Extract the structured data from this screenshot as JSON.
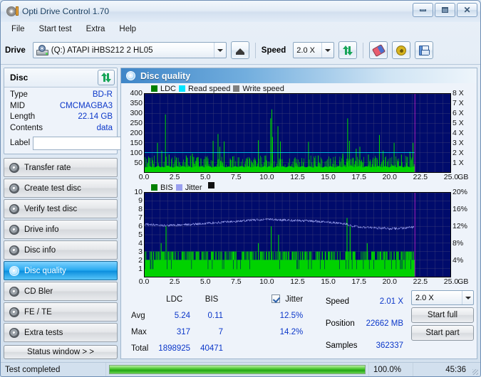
{
  "window": {
    "title": "Opti Drive Control 1.70",
    "icon": "disc-icon",
    "controls": {
      "minimize": "minimize",
      "maximize": "maximize",
      "close": "close"
    }
  },
  "menu": {
    "items": [
      "File",
      "Start test",
      "Extra",
      "Help"
    ]
  },
  "toolbar": {
    "drive_label": "Drive",
    "drive_value": "(Q:)  ATAPI iHBS212  2 HL05",
    "eject_title": "eject",
    "speed_label": "Speed",
    "speed_value": "2.0 X",
    "refresh_title": "refresh",
    "erase_title": "erase",
    "settings_title": "settings",
    "save_title": "save"
  },
  "disc": {
    "title": "Disc",
    "refresh_title": "refresh-disc",
    "rows": [
      {
        "key": "Type",
        "value": "BD-R"
      },
      {
        "key": "MID",
        "value": "CMCMAGBA3"
      },
      {
        "key": "Length",
        "value": "22.14 GB"
      },
      {
        "key": "Contents",
        "value": "data"
      }
    ],
    "label_key": "Label",
    "label_value": "",
    "label_placeholder": ""
  },
  "nav": {
    "items": [
      {
        "label": "Transfer rate",
        "selected": false
      },
      {
        "label": "Create test disc",
        "selected": false
      },
      {
        "label": "Verify test disc",
        "selected": false
      },
      {
        "label": "Drive info",
        "selected": false
      },
      {
        "label": "Disc info",
        "selected": false
      },
      {
        "label": "Disc quality",
        "selected": true
      },
      {
        "label": "CD Bler",
        "selected": false
      },
      {
        "label": "FE / TE",
        "selected": false
      },
      {
        "label": "Extra tests",
        "selected": false
      }
    ],
    "status_window": "Status window > >"
  },
  "panel": {
    "title": "Disc quality",
    "icon": "disc-quality-icon"
  },
  "chart_data": [
    {
      "type": "line",
      "name": "ldc-chart",
      "title": "",
      "xlabel": "GB",
      "ylabel": "",
      "xlim": [
        0,
        25
      ],
      "ylim": [
        0,
        400
      ],
      "xticks": [
        "0.0",
        "2.5",
        "5.0",
        "7.5",
        "10.0",
        "12.5",
        "15.0",
        "17.5",
        "20.0",
        "22.5",
        "25.0"
      ],
      "xtick_values": [
        0,
        2.5,
        5,
        7.5,
        10,
        12.5,
        15,
        17.5,
        20,
        22.5,
        25
      ],
      "yticks": [
        "50",
        "100",
        "150",
        "200",
        "250",
        "300",
        "350",
        "400"
      ],
      "ytick_values": [
        50,
        100,
        150,
        200,
        250,
        300,
        350,
        400
      ],
      "y2label": "",
      "y2lim": [
        0,
        8
      ],
      "y2ticks": [
        "1 X",
        "2 X",
        "3 X",
        "4 X",
        "5 X",
        "6 X",
        "7 X",
        "8 X"
      ],
      "y2tick_values": [
        1,
        2,
        3,
        4,
        5,
        6,
        7,
        8
      ],
      "grid": true,
      "bg": "#000b6b",
      "legend": [
        {
          "label": "LDC",
          "color": "#008000"
        },
        {
          "label": "Read speed",
          "color": "#00e5ff"
        },
        {
          "label": "Write speed",
          "color": "#808080"
        }
      ],
      "data_end_marker_x": 22.1,
      "marker_color": "#c71fc7",
      "series": [
        {
          "name": "LDC",
          "color": "#00d200",
          "type": "spike-area",
          "baseline": [
            22,
            26,
            24,
            28,
            30,
            25,
            27,
            23,
            26,
            29,
            31,
            27,
            25,
            28,
            24,
            26,
            30,
            33,
            29,
            27,
            25,
            23,
            26,
            28,
            30,
            27,
            25,
            29,
            31,
            28,
            26,
            24,
            27,
            30,
            25,
            23,
            26,
            28,
            31,
            27,
            25,
            28,
            30,
            26,
            24,
            27,
            29,
            31,
            28,
            25,
            23,
            26,
            29,
            27,
            25,
            28,
            30,
            32,
            28,
            26,
            24,
            27,
            29,
            25,
            23,
            26,
            28,
            30,
            27,
            25,
            28,
            31,
            29,
            26,
            24,
            27,
            30,
            28,
            25,
            23,
            26,
            29,
            27,
            31,
            28,
            25,
            23,
            27,
            29,
            26,
            24,
            28,
            30,
            27,
            25,
            23,
            26,
            29,
            31,
            27,
            25,
            28,
            30,
            26,
            24,
            27,
            29,
            31,
            28,
            25,
            23,
            26,
            29,
            27,
            25,
            28,
            30,
            28,
            26,
            24,
            27,
            30,
            28,
            25,
            23,
            26,
            29,
            27,
            31,
            28,
            25,
            23,
            26,
            29,
            27,
            24,
            28,
            30,
            27,
            25,
            23,
            26,
            29,
            31,
            28,
            25,
            27,
            30,
            26,
            24,
            28,
            30,
            32,
            29,
            26,
            24,
            27,
            29,
            31,
            28,
            25,
            23,
            27,
            30,
            28,
            25,
            23,
            26,
            29,
            27,
            25,
            28,
            31,
            29,
            26,
            24,
            27,
            30,
            28,
            26,
            24,
            27,
            30,
            32,
            29,
            26,
            24,
            28,
            31,
            29,
            26,
            24,
            27,
            30,
            28,
            25,
            23,
            26,
            29,
            27
          ],
          "spikes": [
            {
              "x": 1.05,
              "y": 150
            },
            {
              "x": 1.4,
              "y": 110
            },
            {
              "x": 1.7,
              "y": 295
            },
            {
              "x": 2.0,
              "y": 90
            },
            {
              "x": 2.6,
              "y": 75
            },
            {
              "x": 3.4,
              "y": 85
            },
            {
              "x": 3.9,
              "y": 95
            },
            {
              "x": 4.6,
              "y": 70
            },
            {
              "x": 5.6,
              "y": 160
            },
            {
              "x": 6.0,
              "y": 195
            },
            {
              "x": 6.15,
              "y": 130
            },
            {
              "x": 6.5,
              "y": 157
            },
            {
              "x": 7.2,
              "y": 80
            },
            {
              "x": 8.6,
              "y": 70
            },
            {
              "x": 9.3,
              "y": 163
            },
            {
              "x": 9.9,
              "y": 85
            },
            {
              "x": 10.3,
              "y": 275
            },
            {
              "x": 10.4,
              "y": 321
            },
            {
              "x": 10.45,
              "y": 180
            },
            {
              "x": 10.9,
              "y": 235
            },
            {
              "x": 11.1,
              "y": 157
            },
            {
              "x": 12.3,
              "y": 75
            },
            {
              "x": 13.4,
              "y": 155
            },
            {
              "x": 14.2,
              "y": 85
            },
            {
              "x": 15.2,
              "y": 70
            },
            {
              "x": 16.2,
              "y": 95
            },
            {
              "x": 16.6,
              "y": 275
            },
            {
              "x": 16.75,
              "y": 160
            },
            {
              "x": 17.3,
              "y": 120
            },
            {
              "x": 17.6,
              "y": 130
            },
            {
              "x": 18.3,
              "y": 90
            },
            {
              "x": 19.2,
              "y": 190
            },
            {
              "x": 19.5,
              "y": 110
            },
            {
              "x": 20.4,
              "y": 150
            },
            {
              "x": 21.0,
              "y": 90
            },
            {
              "x": 21.7,
              "y": 105
            },
            {
              "x": 21.95,
              "y": 150
            }
          ]
        },
        {
          "name": "Read speed",
          "color": "#00e5ff",
          "type": "line",
          "axis": "right",
          "value": 2.01,
          "x_start": 0,
          "x_end": 22.1
        }
      ]
    },
    {
      "type": "line",
      "name": "bis-jitter-chart",
      "title": "",
      "xlabel": "GB",
      "ylabel": "",
      "xlim": [
        0,
        25
      ],
      "ylim": [
        0,
        10
      ],
      "xticks": [
        "0.0",
        "2.5",
        "5.0",
        "7.5",
        "10.0",
        "12.5",
        "15.0",
        "17.5",
        "20.0",
        "22.5",
        "25.0"
      ],
      "xtick_values": [
        0,
        2.5,
        5,
        7.5,
        10,
        12.5,
        15,
        17.5,
        20,
        22.5,
        25
      ],
      "yticks": [
        "1",
        "2",
        "3",
        "4",
        "5",
        "6",
        "7",
        "8",
        "9",
        "10"
      ],
      "ytick_values": [
        1,
        2,
        3,
        4,
        5,
        6,
        7,
        8,
        9,
        10
      ],
      "y2lim": [
        0,
        20
      ],
      "y2ticks": [
        "4%",
        "8%",
        "12%",
        "16%",
        "20%"
      ],
      "y2tick_values": [
        4,
        8,
        12,
        16,
        20
      ],
      "grid": true,
      "bg": "#000b6b",
      "legend": [
        {
          "label": "BIS",
          "color": "#008000"
        },
        {
          "label": "Jitter",
          "color": "#9aa0f0"
        }
      ],
      "data_end_marker_x": 22.1,
      "marker_color": "#c71fc7",
      "series": [
        {
          "name": "BIS",
          "color": "#00d200",
          "type": "spike-area",
          "baseline_level": 2,
          "spikes_level3_density": 0.32,
          "spikes": [
            {
              "x": 1.35,
              "y": 4
            },
            {
              "x": 1.75,
              "y": 6
            },
            {
              "x": 2.3,
              "y": 3
            },
            {
              "x": 3.1,
              "y": 3
            },
            {
              "x": 4.2,
              "y": 3
            },
            {
              "x": 5.6,
              "y": 3
            },
            {
              "x": 6.3,
              "y": 3
            },
            {
              "x": 7.1,
              "y": 3
            },
            {
              "x": 9.3,
              "y": 4
            },
            {
              "x": 10.35,
              "y": 6
            },
            {
              "x": 10.95,
              "y": 5
            },
            {
              "x": 12.1,
              "y": 3
            },
            {
              "x": 13.5,
              "y": 3
            },
            {
              "x": 14.8,
              "y": 3
            },
            {
              "x": 16.55,
              "y": 7
            },
            {
              "x": 16.8,
              "y": 6
            },
            {
              "x": 17.2,
              "y": 3
            },
            {
              "x": 18.2,
              "y": 4
            },
            {
              "x": 19.3,
              "y": 3
            },
            {
              "x": 20.4,
              "y": 3
            },
            {
              "x": 21.4,
              "y": 3
            }
          ]
        },
        {
          "name": "Jitter",
          "color": "#9aa0f0",
          "type": "line",
          "axis": "right",
          "points": [
            [
              0.0,
              12.5
            ],
            [
              0.5,
              12.4
            ],
            [
              1.0,
              12.3
            ],
            [
              1.5,
              12.2
            ],
            [
              2.0,
              12.3
            ],
            [
              2.5,
              12.3
            ],
            [
              3.0,
              12.4
            ],
            [
              3.5,
              12.4
            ],
            [
              4.0,
              12.5
            ],
            [
              4.5,
              12.6
            ],
            [
              5.0,
              12.7
            ],
            [
              5.5,
              12.8
            ],
            [
              6.0,
              12.9
            ],
            [
              6.5,
              13.0
            ],
            [
              7.0,
              13.1
            ],
            [
              7.5,
              13.2
            ],
            [
              8.0,
              13.3
            ],
            [
              8.5,
              13.4
            ],
            [
              9.0,
              13.5
            ],
            [
              9.5,
              13.6
            ],
            [
              10.0,
              13.7
            ],
            [
              10.5,
              13.6
            ],
            [
              11.0,
              13.5
            ],
            [
              11.5,
              13.5
            ],
            [
              12.0,
              13.4
            ],
            [
              12.5,
              13.4
            ],
            [
              13.0,
              13.3
            ],
            [
              13.5,
              13.3
            ],
            [
              14.0,
              13.2
            ],
            [
              14.5,
              13.1
            ],
            [
              15.0,
              13.0
            ],
            [
              15.5,
              12.9
            ],
            [
              16.0,
              12.7
            ],
            [
              16.5,
              12.5
            ],
            [
              17.0,
              12.1
            ],
            [
              17.5,
              11.9
            ],
            [
              18.0,
              11.8
            ],
            [
              18.5,
              11.7
            ],
            [
              19.0,
              11.6
            ],
            [
              19.5,
              11.6
            ],
            [
              20.0,
              11.5
            ],
            [
              20.5,
              11.5
            ],
            [
              21.0,
              11.6
            ],
            [
              21.5,
              11.7
            ],
            [
              22.0,
              11.8
            ]
          ]
        }
      ]
    }
  ],
  "stats": {
    "col_headers": [
      "LDC",
      "BIS"
    ],
    "row_labels": [
      "Avg",
      "Max",
      "Total"
    ],
    "ldc": {
      "avg": "5.24",
      "max": "317",
      "total": "1898925"
    },
    "bis": {
      "avg": "0.11",
      "max": "7",
      "total": "40471"
    },
    "jitter": {
      "label": "Jitter",
      "checked": true,
      "avg": "12.5%",
      "max": "14.2%"
    },
    "readout": [
      {
        "key": "Speed",
        "value": "2.01 X"
      },
      {
        "key": "Position",
        "value": "22662 MB"
      },
      {
        "key": "Samples",
        "value": "362337"
      }
    ],
    "speed_select": "2.0 X",
    "start_full": "Start full",
    "start_part": "Start part"
  },
  "statusbar": {
    "message": "Test completed",
    "progress_percent": 100.0,
    "progress_text": "100.0%",
    "elapsed": "45:36"
  }
}
